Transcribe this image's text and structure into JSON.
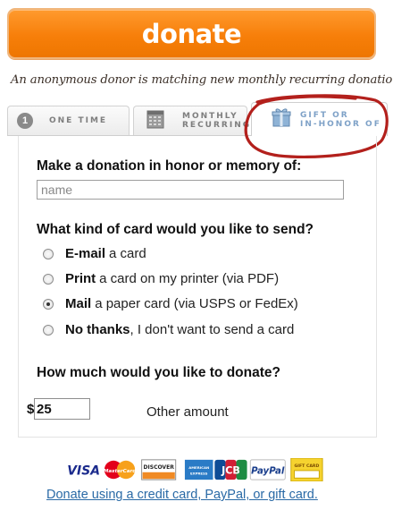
{
  "donate_button": {
    "label": "donate"
  },
  "banner": {
    "text": "An anonymous donor is matching new monthly recurring donations!"
  },
  "tabs": [
    {
      "label_line1": "ONE TIME",
      "label_line2": "",
      "number": "1",
      "active": false
    },
    {
      "label_line1": "MONTHLY",
      "label_line2": "RECURRING",
      "active": false
    },
    {
      "label_line1": "GIFT OR",
      "label_line2": "IN-HONOR OF",
      "active": true
    }
  ],
  "honor": {
    "heading": "Make a donation in honor or memory of:",
    "name_placeholder": "name"
  },
  "card_question": {
    "heading": "What kind of card would you like to send?",
    "options": [
      {
        "bold": "E-mail",
        "rest": "a card",
        "selected": false
      },
      {
        "bold": "Print",
        "rest": "a card on my printer (via PDF)",
        "selected": false
      },
      {
        "bold": "Mail",
        "rest": "a paper card (via USPS or FedEx)",
        "selected": true
      },
      {
        "bold": "No thanks",
        "rest": ", I don't want to send a card",
        "selected": false
      }
    ]
  },
  "amount": {
    "heading": "How much would you like to donate?",
    "currency": "$",
    "value": "25",
    "other_label": "Other amount"
  },
  "payment": {
    "logos": {
      "visa": "VISA",
      "mastercard": "MasterCard",
      "discover": "DISCOVER",
      "amex": "AMERICAN EXPRESS",
      "jcb": "JCB",
      "paypal": "PayPal",
      "giftcard": "GIFT CARD"
    },
    "link_text": "Donate using a credit card, PayPal, or gift card."
  },
  "colors": {
    "donate_orange": "#f7820c",
    "annotation_red": "#b3201c",
    "link_blue": "#2a6aa6"
  }
}
